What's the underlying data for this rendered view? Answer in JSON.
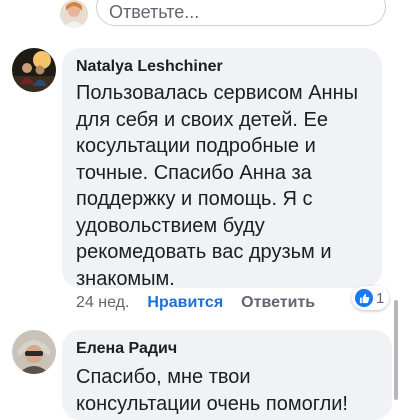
{
  "reply_box": {
    "placeholder": "Ответьте..."
  },
  "comments": [
    {
      "author": "Natalya Leshchiner",
      "text": "Пользовалась сервисом Анны\nдля себя и своих детей. Ее\nкосультации подробные и\nточные.  Спасибо Анна за\nподдержку и помощь.  Я с\nудовольствием буду\nрекомедовать вас друзьм и\nзнакомым.",
      "age": "24 нед.",
      "like_label": "Нравится",
      "reply_label": "Ответить",
      "reaction_count": "1"
    },
    {
      "author": "Елена Радич",
      "text": "Спасибо, мне твои\nконсультации очень помогли!"
    }
  ],
  "colors": {
    "bubble": "#f0f2f5",
    "like_blue": "#216fdb",
    "reaction_blue": "#1877f2",
    "muted": "#606770"
  }
}
